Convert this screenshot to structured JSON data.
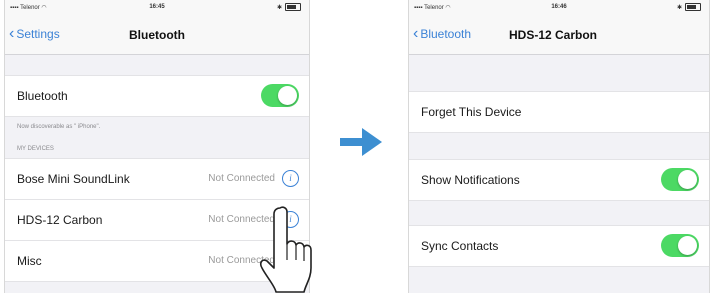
{
  "screen1": {
    "status": {
      "carrier": "Telenor",
      "time": "16:45"
    },
    "nav": {
      "back": "Settings",
      "title": "Bluetooth"
    },
    "bluetooth_row": {
      "label": "Bluetooth",
      "on": true
    },
    "discoverable_note": "Now discoverable as \"         iPhone\".",
    "section_header": "MY DEVICES",
    "devices": [
      {
        "name": "Bose Mini SoundLink",
        "status": "Not Connected"
      },
      {
        "name": "HDS-12 Carbon",
        "status": "Not Connected"
      },
      {
        "name": "Misc",
        "status": "Not Connected"
      }
    ]
  },
  "screen2": {
    "status": {
      "carrier": "Telenor",
      "time": "16:46"
    },
    "nav": {
      "back": "Bluetooth",
      "title": "HDS-12 Carbon"
    },
    "forget": "Forget This Device",
    "show_notifications": {
      "label": "Show Notifications",
      "on": true
    },
    "sync_contacts": {
      "label": "Sync Contacts",
      "on": true
    }
  },
  "icons": {
    "arrow": "right-arrow-icon",
    "hand": "pointing-hand-icon",
    "info": "info-icon"
  },
  "colors": {
    "accent": "#3b82d6",
    "toggle_on": "#4cd964",
    "arrow": "#3d8fd1"
  }
}
